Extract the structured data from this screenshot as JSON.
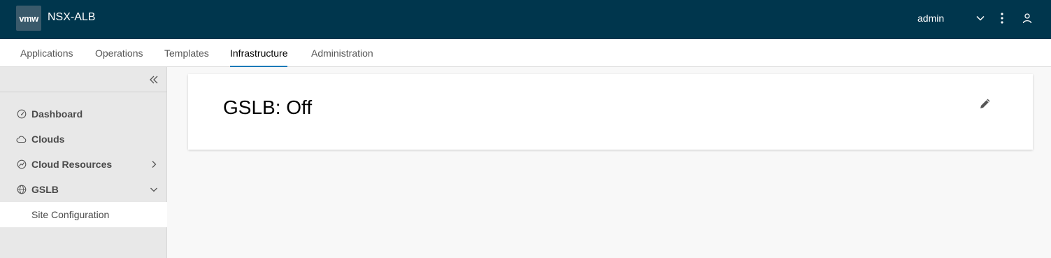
{
  "header": {
    "logo_text": "vmw",
    "app_title": "NSX-ALB",
    "user": "admin",
    "icons": [
      "chevron-down-icon",
      "kebab-menu-icon",
      "user-icon"
    ],
    "bg_color": "#00364d"
  },
  "nav": {
    "tabs": [
      {
        "label": "Applications",
        "active": false
      },
      {
        "label": "Operations",
        "active": false
      },
      {
        "label": "Templates",
        "active": false
      },
      {
        "label": "Infrastructure",
        "active": true
      },
      {
        "label": "Administration",
        "active": false
      }
    ],
    "active_color": "#0079b8"
  },
  "sidebar": {
    "items": [
      {
        "label": "Dashboard",
        "icon": "dashboard-icon"
      },
      {
        "label": "Clouds",
        "icon": "cloud-icon"
      },
      {
        "label": "Cloud Resources",
        "icon": "cloud-resources-icon",
        "expandable": "collapsed"
      },
      {
        "label": "GSLB",
        "icon": "globe-icon",
        "expandable": "expanded"
      }
    ],
    "sub_item": {
      "label": "Site Configuration",
      "selected": true
    }
  },
  "main": {
    "card_title": "GSLB: Off",
    "edit_icon": "pencil-icon"
  }
}
